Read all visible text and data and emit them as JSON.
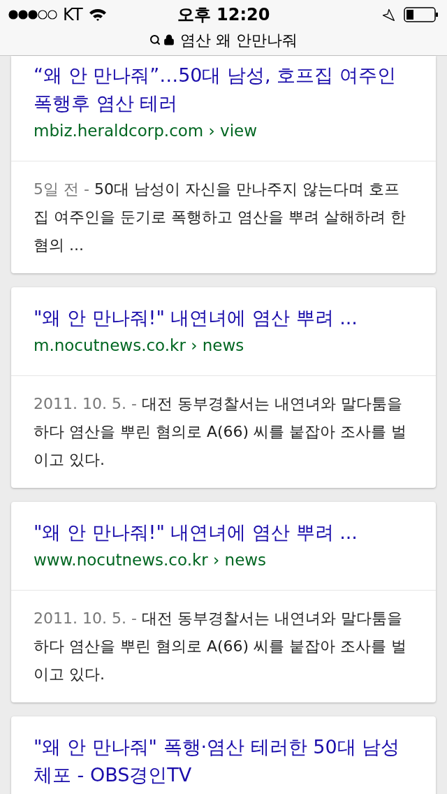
{
  "status_bar": {
    "carrier": "KT",
    "time": "오후 12:20"
  },
  "address_bar": {
    "query": "염산 왜 안만나줘"
  },
  "results": [
    {
      "title": "“왜 안 만나줘”…50대 남성, 호프집 여주인 폭행후 염산 테러",
      "url": "mbiz.heraldcorp.com › view",
      "date": "5일 전 -",
      "snippet": "50대 남성이 자신을 만나주지 않는다며 호프집 여주인을 둔기로 폭행하고 염산을 뿌려 살해하려 한 혐의 ..."
    },
    {
      "title": "\"왜 안 만나줘!\" 내연녀에 염산 뿌려 ...",
      "url": "m.nocutnews.co.kr › news",
      "date": "2011. 10. 5. -",
      "snippet": "대전 동부경찰서는 내연녀와 말다툼을 하다 염산을 뿌린 혐의로 A(66) 씨를 붙잡아 조사를 벌이고 있다."
    },
    {
      "title": "\"왜 안 만나줘!\" 내연녀에 염산 뿌려 ...",
      "url": "www.nocutnews.co.kr › news",
      "date": "2011. 10. 5. -",
      "snippet": "대전 동부경찰서는 내연녀와 말다툼을 하다 염산을 뿌린 혐의로 A(66) 씨를 붙잡아 조사를 벌이고 있다."
    },
    {
      "title": "\"왜 안 만나줘\" 폭행·염산 테러한 50대 남성 체포 - OBS경인TV"
    }
  ]
}
